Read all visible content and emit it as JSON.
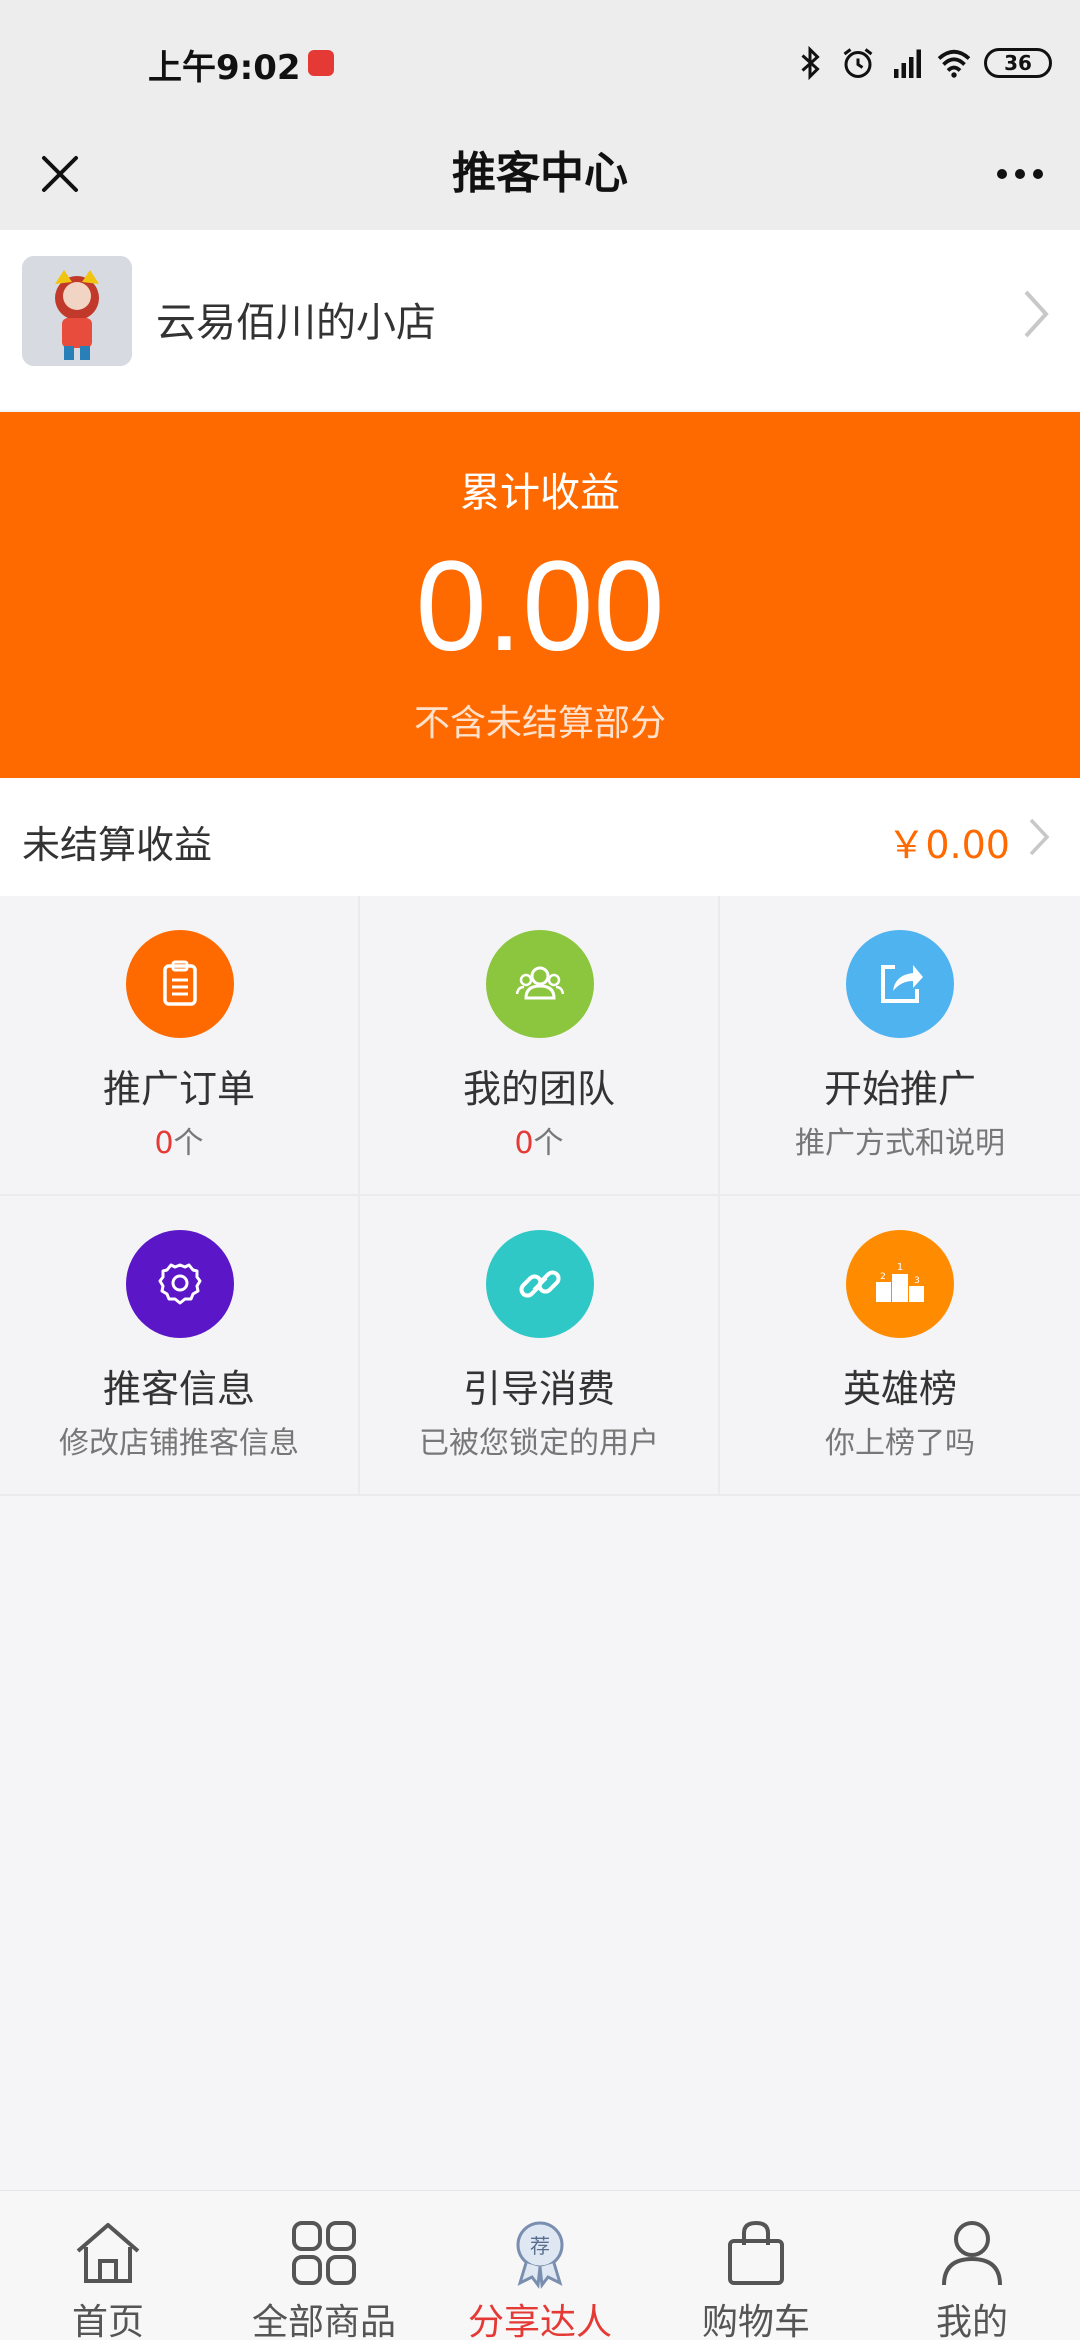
{
  "status": {
    "time": "上午9:02",
    "battery": "36"
  },
  "nav": {
    "title": "推客中心"
  },
  "shop": {
    "name": "云易佰川的小店"
  },
  "earnings": {
    "label": "累计收益",
    "amount": "0.00",
    "note": "不含未结算部分"
  },
  "unsettled": {
    "label": "未结算收益",
    "value": "￥0.00"
  },
  "grid": [
    {
      "title": "推广订单",
      "count": "0",
      "unit": "个",
      "color": "#ff6a00",
      "icon": "clipboard-icon"
    },
    {
      "title": "我的团队",
      "count": "0",
      "unit": "个",
      "color": "#8cc63f",
      "icon": "team-icon"
    },
    {
      "title": "开始推广",
      "sub": "推广方式和说明",
      "color": "#4fb3f0",
      "icon": "share-icon"
    },
    {
      "title": "推客信息",
      "sub": "修改店铺推客信息",
      "color": "#5b17c7",
      "icon": "gear-icon"
    },
    {
      "title": "引导消费",
      "sub": "已被您锁定的用户",
      "color": "#2fc8c6",
      "icon": "link-icon"
    },
    {
      "title": "英雄榜",
      "sub": "你上榜了吗",
      "color": "#ff8c00",
      "icon": "podium-icon"
    }
  ],
  "tabs": [
    {
      "label": "首页",
      "icon": "home-icon"
    },
    {
      "label": "全部商品",
      "icon": "grid-icon"
    },
    {
      "label": "分享达人",
      "icon": "recommend-badge-icon",
      "active": true
    },
    {
      "label": "购物车",
      "icon": "shopping-bag-icon"
    },
    {
      "label": "我的",
      "icon": "user-icon"
    }
  ]
}
